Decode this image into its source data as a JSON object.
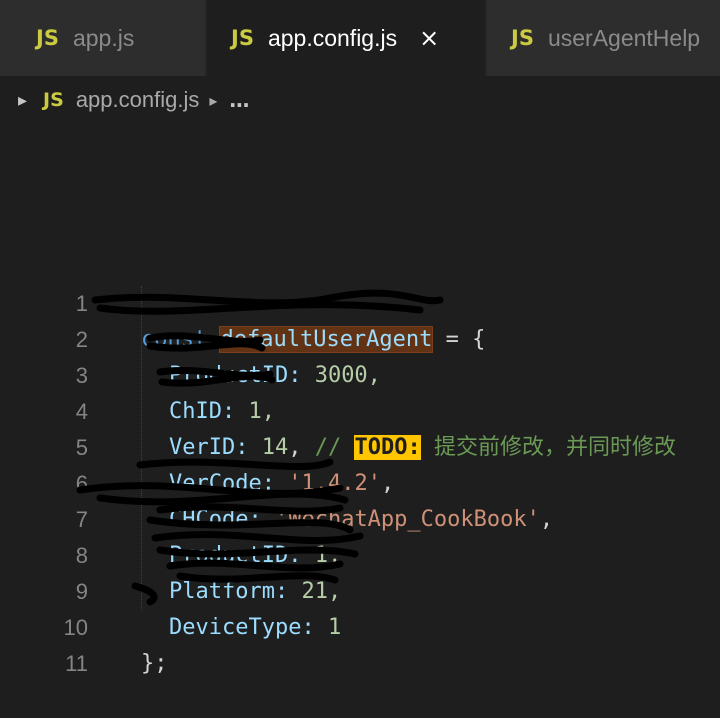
{
  "tabs": [
    {
      "icon": "JS",
      "label": "app.js"
    },
    {
      "icon": "JS",
      "label": "app.config.js",
      "close": "×"
    },
    {
      "icon": "JS",
      "label": "userAgentHelp"
    }
  ],
  "breadcrumb": {
    "icon": "JS",
    "file": "app.config.js",
    "more": "…"
  },
  "lines": [
    {
      "n": "1",
      "kw": "const",
      "name": "defaultUserAgent",
      "rest": " = {"
    },
    {
      "n": "2",
      "prop": "ProductID:",
      "rest": " 3000,"
    },
    {
      "n": "3",
      "prop": "ChID:",
      "rest": " 1,"
    },
    {
      "n": "4",
      "prop": "VerID:",
      "num": " 14",
      "rest": ", ",
      "comment": "// ",
      "todo": "TODO:",
      "comment_text": " 提交前修改，并同时修改"
    },
    {
      "n": "5",
      "prop": "VerCode:",
      "str": "'1.4.2'",
      "rest": ","
    },
    {
      "n": "6",
      "prop": "CHCode:",
      "str": "'WechatApp_CookBook'",
      "rest": ","
    },
    {
      "n": "7",
      "prop": "ProductID:",
      "rest": " 1,"
    },
    {
      "n": "8",
      "prop": "Platform:",
      "rest": " 21,"
    },
    {
      "n": "9",
      "prop": "DeviceType:",
      "rest": " 1"
    },
    {
      "n": "10",
      "rest": "};"
    },
    {
      "n": "11"
    }
  ]
}
